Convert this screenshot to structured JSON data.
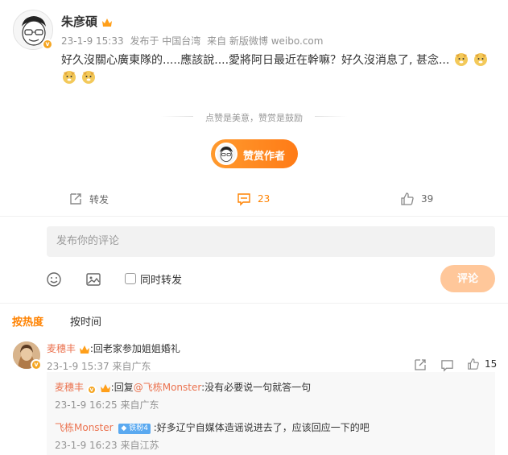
{
  "post": {
    "author": "朱彦碩",
    "meta_time": "23-1-9 15:33",
    "meta_location": "发布于 中国台湾",
    "meta_source": "来自 新版微博 weibo.com",
    "text": "好久沒關心廣東隊的.....應該說....愛將阿日最近在幹嘛？好久沒消息了, 甚念...",
    "emoji_name": "doge-emoji"
  },
  "reward": {
    "caption": "点赞是美意，赞赏是鼓励",
    "button_label": "赞赏作者"
  },
  "actions": {
    "repost_label": "转发",
    "comment_count": "23",
    "like_count": "39"
  },
  "composer": {
    "placeholder": "发布你的评论",
    "forward_label": "同时转发",
    "submit_label": "评论"
  },
  "sort": {
    "hot_label": "按热度",
    "time_label": "按时间"
  },
  "comments": [
    {
      "user": "麦穗丰",
      "text": ":回老家参加姐姐婚礼",
      "time": "23-1-9 15:37",
      "location": "来自广东",
      "likes": "15"
    }
  ],
  "replies": [
    {
      "user": "麦穗丰",
      "prefix": ":回复",
      "mention": "@飞栋Monster",
      "text": ":没有必要说一句就答一句",
      "time": "23-1-9 16:25",
      "location": "来自广东"
    },
    {
      "user": "飞栋Monster",
      "badge": "铁粉4",
      "text": ":好多辽宁自媒体造谣说进去了，应该回应一下的吧",
      "time": "23-1-9 16:23",
      "location": "来自江苏"
    }
  ],
  "colors": {
    "accent": "#ff8200",
    "name": "#eb7350",
    "meta": "#939393"
  }
}
